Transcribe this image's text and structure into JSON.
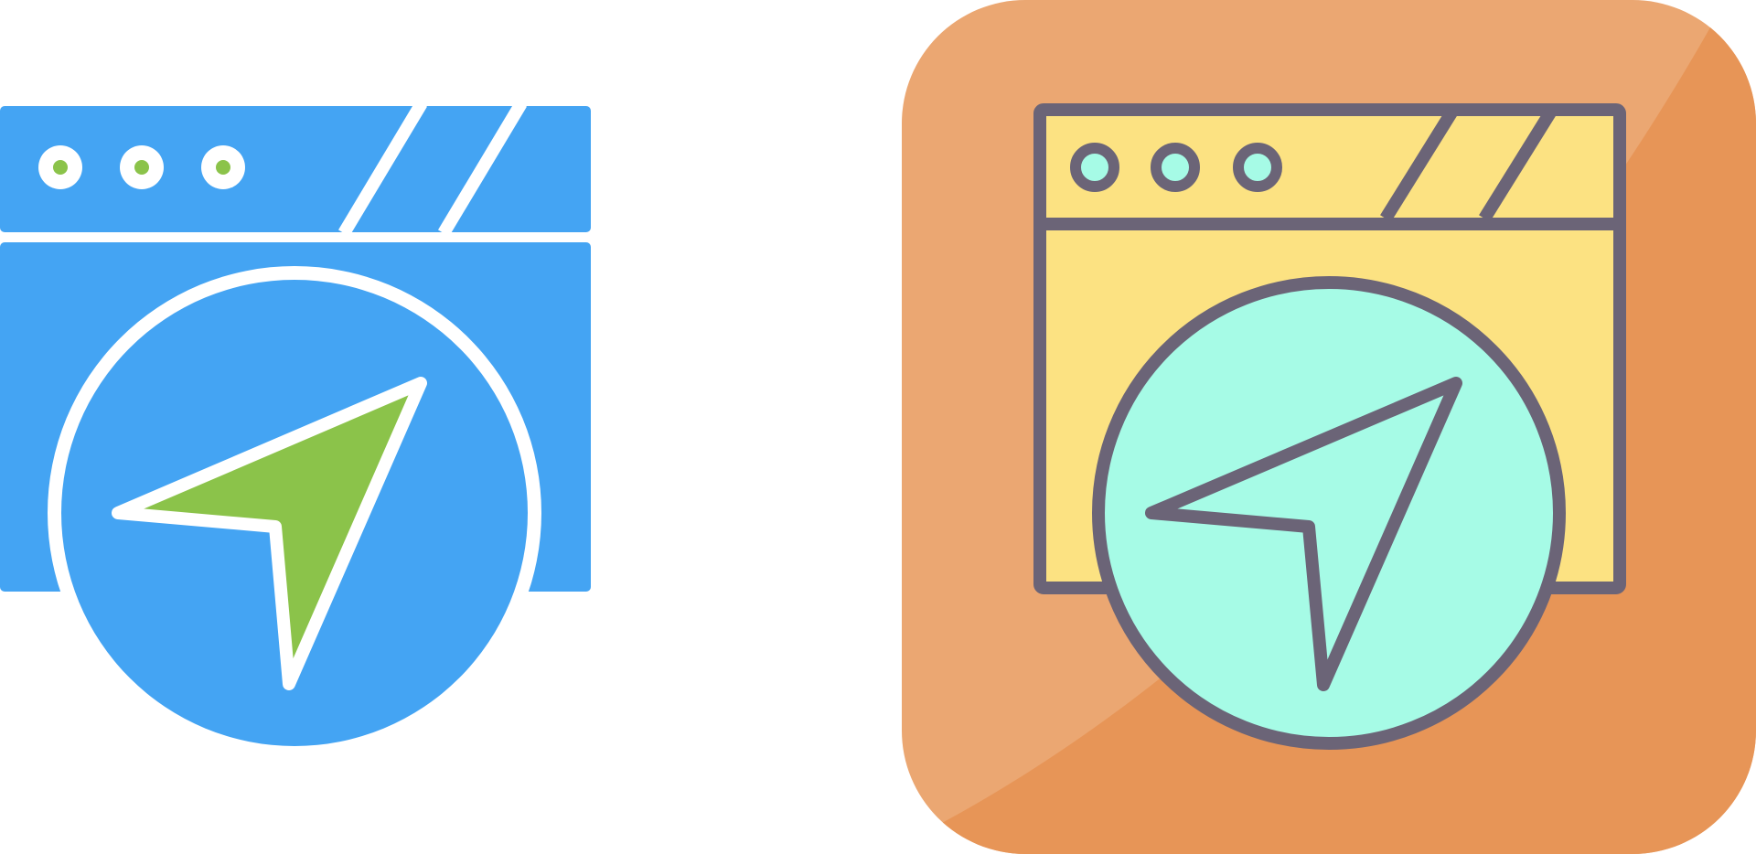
{
  "icons": [
    {
      "name": "browser-navigation-icon-flat",
      "style": "flat",
      "colors": {
        "body": "#44A4F3",
        "outline": "#FFFFFF",
        "dots": "#8BC34A",
        "arrow": "#8BC34A"
      }
    },
    {
      "name": "browser-navigation-icon-filled-outline",
      "style": "filled-outline",
      "colors": {
        "tile": "#EBA772",
        "tile_shadow": "#E79557",
        "window": "#FCE282",
        "circle": "#A6FBE6",
        "outline": "#6B6477"
      }
    }
  ]
}
